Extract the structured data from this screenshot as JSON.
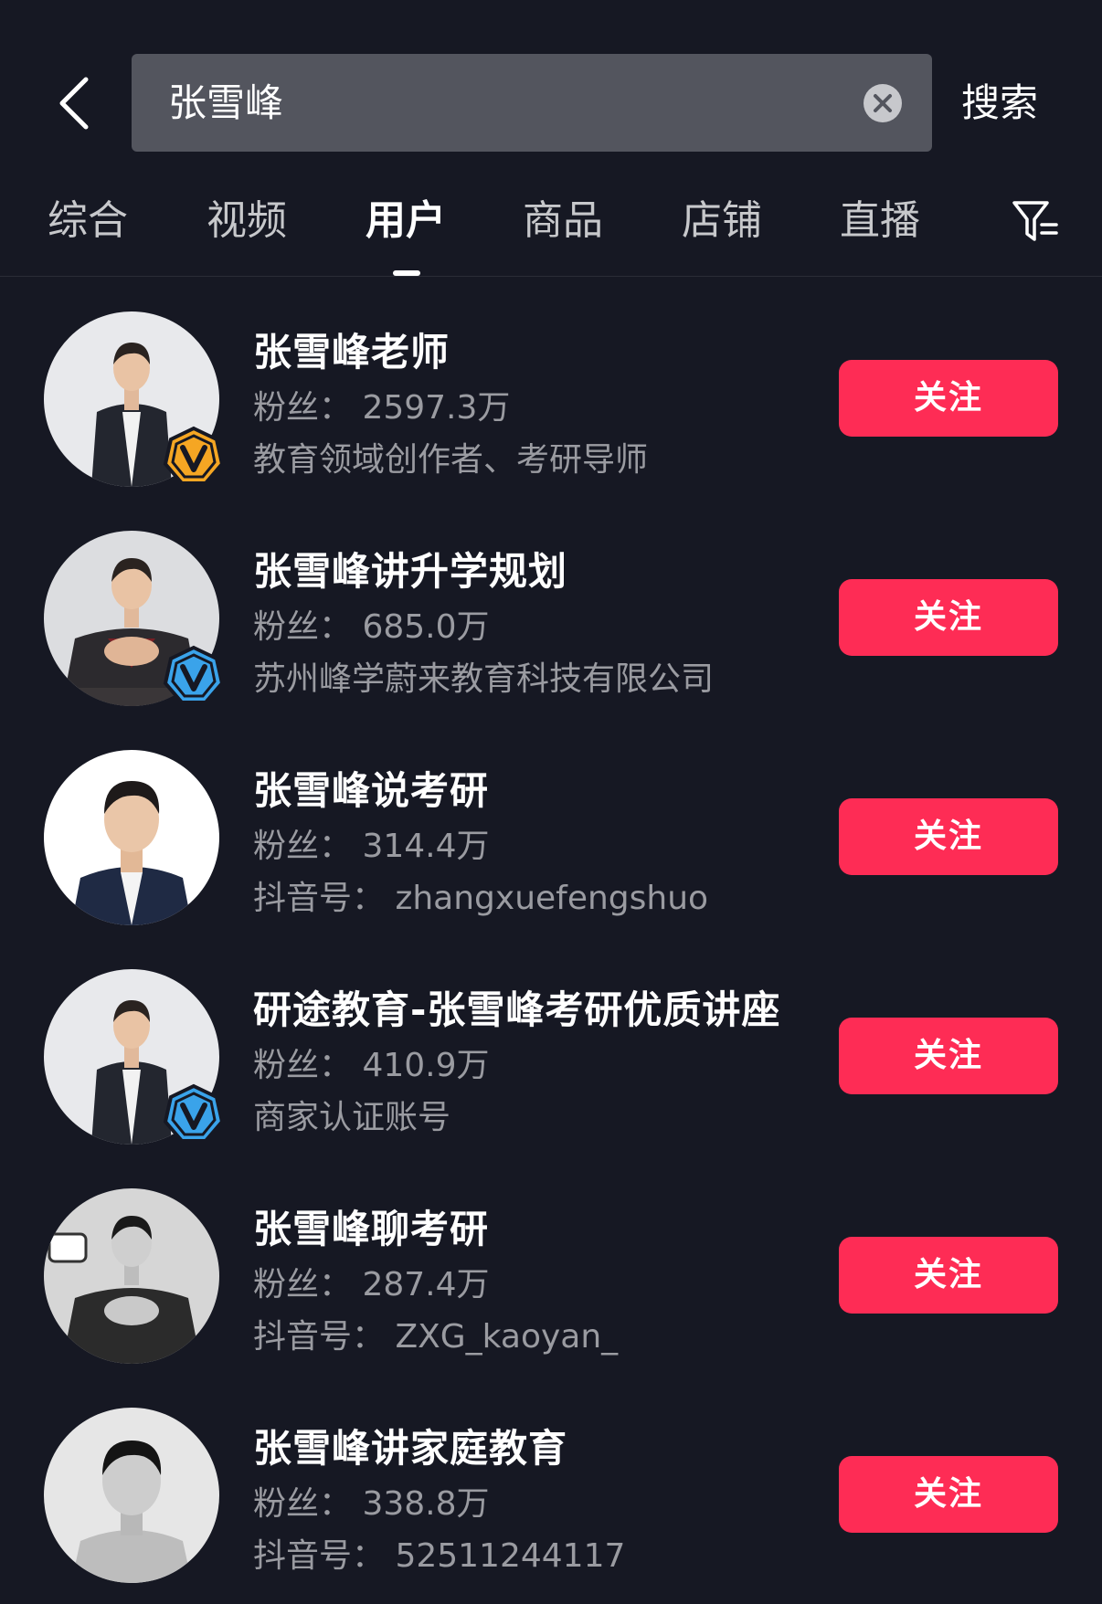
{
  "header": {
    "search_query": "张雪峰",
    "search_button_label": "搜索"
  },
  "tabs": [
    {
      "label": "综合"
    },
    {
      "label": "视频"
    },
    {
      "label": "用户",
      "active": true
    },
    {
      "label": "商品"
    },
    {
      "label": "店铺"
    },
    {
      "label": "直播"
    }
  ],
  "colors": {
    "background": "#161823",
    "follow_button": "#fe2c55",
    "badge_gold": "#f5a623",
    "badge_blue": "#3aa3ea",
    "secondary_text": "#9a9ba1"
  },
  "users": [
    {
      "name": "张雪峰老师",
      "fans": "粉丝：  2597.3万",
      "desc": "教育领域创作者、考研导师",
      "badge": "gold",
      "avatar_icon": "man-in-suit-avatar",
      "follow_label": "关注"
    },
    {
      "name": "张雪峰讲升学规划",
      "fans": "粉丝：  685.0万",
      "desc": "苏州峰学蔚来教育科技有限公司",
      "badge": "blue",
      "avatar_icon": "man-hands-clasped-avatar",
      "follow_label": "关注"
    },
    {
      "name": "张雪峰说考研",
      "fans": "粉丝：  314.4万",
      "desc": "抖音号：  zhangxuefengshuo",
      "badge": "none",
      "avatar_icon": "man-portrait-avatar",
      "follow_label": "关注"
    },
    {
      "name": "研途教育-张雪峰考研优质讲座",
      "fans": "粉丝：  410.9万",
      "desc": "商家认证账号",
      "badge": "blue",
      "avatar_icon": "man-in-suit-avatar",
      "follow_label": "关注"
    },
    {
      "name": "张雪峰聊考研",
      "fans": "粉丝：  287.4万",
      "desc": "抖音号：  ZXG_kaoyan_",
      "badge": "none",
      "avatar_icon": "man-bw-hands-clasped-avatar",
      "follow_label": "关注"
    },
    {
      "name": "张雪峰讲家庭教育",
      "fans": "粉丝：  338.8万",
      "desc": "抖音号：  52511244117",
      "badge": "none",
      "avatar_icon": "man-bw-portrait-avatar",
      "follow_label": "关注"
    }
  ]
}
